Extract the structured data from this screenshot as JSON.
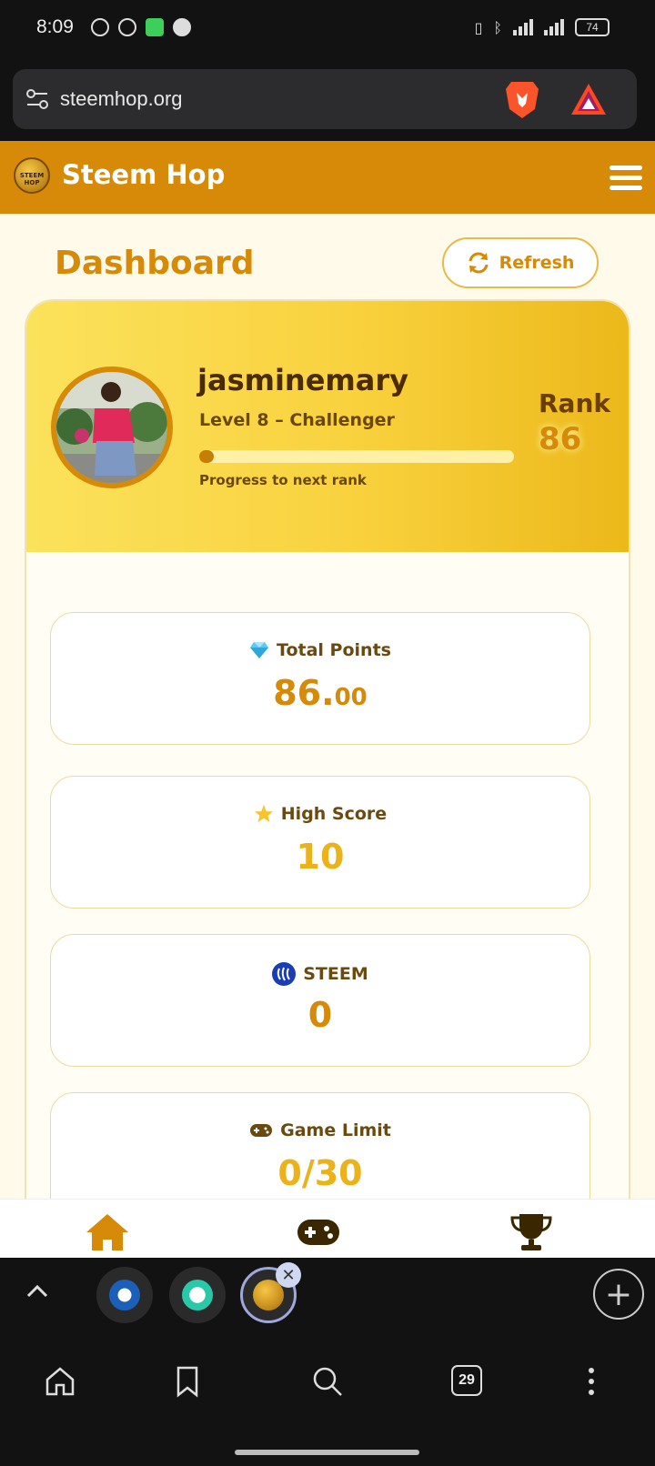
{
  "status_bar": {
    "time": "8:09",
    "battery": "74"
  },
  "browser": {
    "url": "steemhop.org",
    "tab_count": "29",
    "icons": [
      "tune-icon",
      "brave-lion-icon",
      "bat-triangle-icon",
      "chevron-up-icon",
      "add-tab-icon",
      "home-icon",
      "bookmark-icon",
      "search-icon",
      "tabs-icon",
      "more-vert-icon"
    ]
  },
  "site": {
    "logo_text": "STEEM HOP",
    "title": "Steem Hop",
    "brand_color": "#d68a07",
    "accent_color": "#f9d13d"
  },
  "dashboard": {
    "title": "Dashboard",
    "refresh_label": "Refresh",
    "profile": {
      "username": "jasminemary",
      "level": "Level 8 – Challenger",
      "progress_label": "Progress to next rank",
      "progress_fraction": 0.03,
      "rank_label": "Rank",
      "rank_value": "86"
    },
    "stats": [
      {
        "icon": "gem-icon",
        "label": "Total Points",
        "value_main": "86.",
        "value_decimals": "00"
      },
      {
        "icon": "star-icon",
        "label": "High Score",
        "value": "10"
      },
      {
        "icon": "steem-icon",
        "label": "STEEM",
        "value": "0"
      },
      {
        "icon": "gamepad-icon",
        "label": "Game Limit",
        "value": "0/30"
      }
    ]
  },
  "bottom_nav": [
    "home-icon",
    "gamepad-icon",
    "trophy-icon"
  ]
}
